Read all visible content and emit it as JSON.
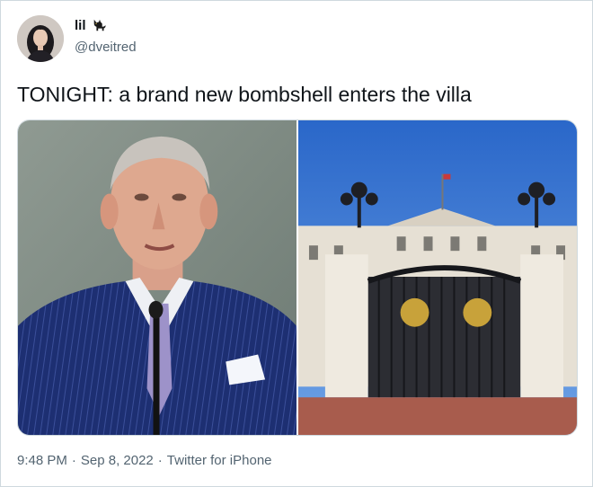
{
  "tweet": {
    "author": {
      "display_name": "lil",
      "display_name_emoji": "cat-icon",
      "handle": "@dveitred",
      "avatar": "avatar"
    },
    "text": "TONIGHT: a brand new bombshell enters the villa",
    "media": [
      {
        "kind": "photo",
        "subject": "man in navy pinstripe suit"
      },
      {
        "kind": "photo",
        "subject": "palace gates"
      }
    ],
    "meta": {
      "time": "9:48 PM",
      "separator": "·",
      "date": "Sep 8, 2022",
      "source": "Twitter for iPhone"
    }
  },
  "colors": {
    "text_primary": "#0f1419",
    "text_secondary": "#536471",
    "border": "#cfd9de"
  }
}
